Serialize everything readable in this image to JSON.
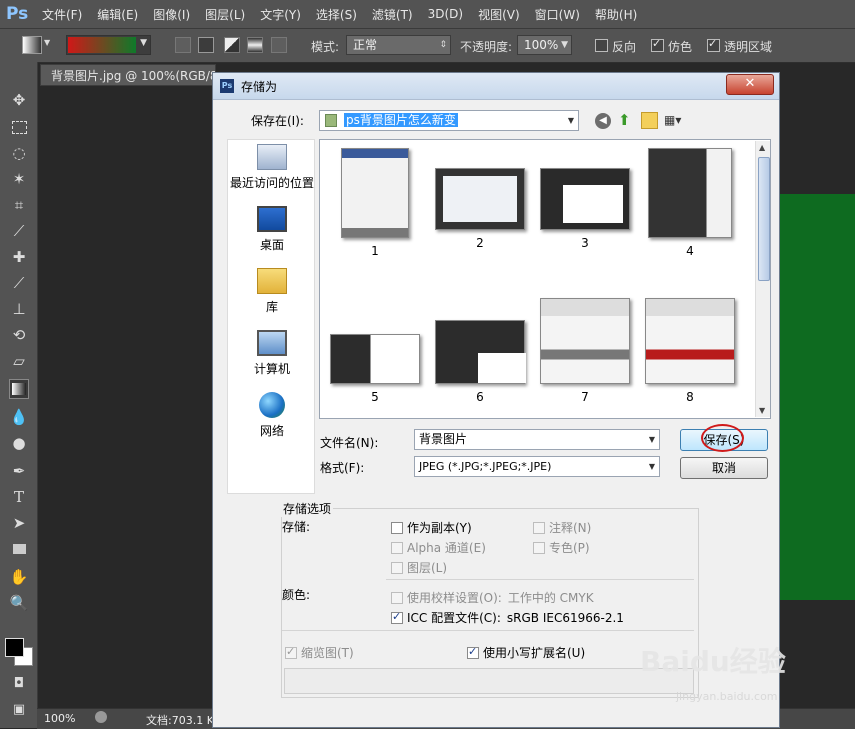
{
  "app": {
    "logo": "Ps"
  },
  "menu": [
    "文件(F)",
    "编辑(E)",
    "图像(I)",
    "图层(L)",
    "文字(Y)",
    "选择(S)",
    "滤镜(T)",
    "3D(D)",
    "视图(V)",
    "窗口(W)",
    "帮助(H)"
  ],
  "options": {
    "mode_label": "模式:",
    "mode_value": "正常",
    "opacity_label": "不透明度:",
    "opacity_value": "100%",
    "reverse_label": "反向",
    "dither_label": "仿色",
    "transparency_label": "透明区域",
    "gradient_colors": [
      "#d01818",
      "#0e7a2a"
    ]
  },
  "document": {
    "tab_title": "背景图片.jpg @ 100%(RGB/8)",
    "canvas_color": "#0e6b20"
  },
  "status": {
    "zoom": "100%",
    "doc_info": "文档:703.1 K"
  },
  "dialog": {
    "title": "存储为",
    "save_in_label": "保存在(I):",
    "save_in_value": "ps背景图片怎么新变",
    "places": [
      "最近访问的位置",
      "桌面",
      "库",
      "计算机",
      "网络"
    ],
    "files": [
      "1",
      "2",
      "3",
      "4",
      "5",
      "6",
      "7",
      "8"
    ],
    "filename_label": "文件名(N):",
    "filename_value": "背景图片",
    "format_label": "格式(F):",
    "format_value": "JPEG (*.JPG;*.JPEG;*.JPE)",
    "save_button": "保存(S)",
    "cancel_button": "取消",
    "options_group_title": "存储选项",
    "save_label": "存储:",
    "as_copy": "作为副本(Y)",
    "notes": "注释(N)",
    "alpha": "Alpha 通道(E)",
    "spot": "专色(P)",
    "layers": "图层(L)",
    "color_label": "颜色:",
    "proof": "使用校样设置(O):",
    "proof_value": "工作中的 CMYK",
    "icc": "ICC 配置文件(C):",
    "icc_value": "sRGB IEC61966-2.1",
    "thumbnail": "缩览图(T)",
    "lowercase_ext": "使用小写扩展名(U)"
  },
  "watermark": {
    "text": "Baidu经验",
    "sub": "jingyan.baidu.com"
  }
}
